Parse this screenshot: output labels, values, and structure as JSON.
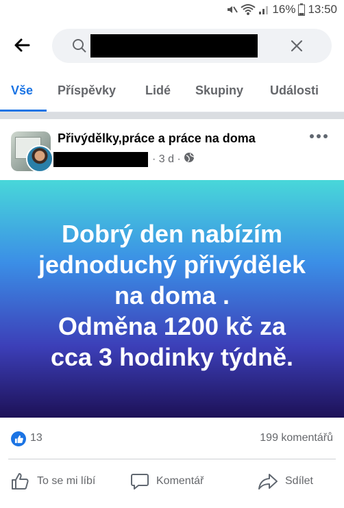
{
  "status": {
    "battery": "16%",
    "time": "13:50"
  },
  "search": {
    "query_redacted": true
  },
  "tabs": [
    {
      "label": "Vše",
      "active": true
    },
    {
      "label": "Příspěvky",
      "active": false
    },
    {
      "label": "Lidé",
      "active": false
    },
    {
      "label": "Skupiny",
      "active": false
    },
    {
      "label": "Události",
      "active": false
    }
  ],
  "post": {
    "group_name": "Přivýdělky,práce a práce na doma",
    "time": "· 3 d ·",
    "banner_lines": [
      "Dobrý den nabízím",
      "jednoduchý přivýdělek",
      "na doma .",
      "Odměna 1200 kč za",
      "cca 3 hodinky týdně."
    ],
    "like_count": "13",
    "comment_count": "199 komentářů"
  },
  "actions": {
    "like": "To se mi líbí",
    "comment": "Komentář",
    "share": "Sdílet"
  },
  "colors": {
    "accent": "#1b74e4",
    "banner_top": "#48d7d9",
    "banner_bottom": "#1d1157"
  }
}
